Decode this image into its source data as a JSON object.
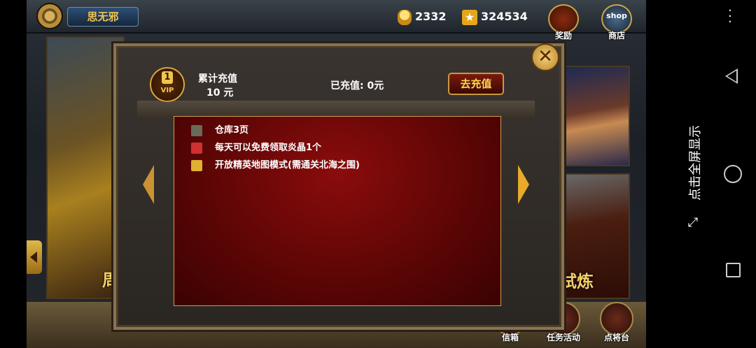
{
  "player": {
    "name": "思无邪"
  },
  "resources": {
    "gold": "2332",
    "gems": "324534"
  },
  "top_buttons": {
    "reward": "奖励",
    "shop_label": "商店",
    "shop_badge": "shop"
  },
  "side_text": {
    "banner": "试炼",
    "left_banner": "周"
  },
  "dialog": {
    "vip_level": "1",
    "vip_text": "VIP",
    "cumulative_title": "累计充值",
    "cumulative_amount": "10 元",
    "charged": "已充值: 0元",
    "recharge_button": "去充值",
    "close": "✕",
    "benefits": [
      {
        "icon": "chest-icon",
        "text": "仓库3页"
      },
      {
        "icon": "gift-icon",
        "text": "每天可以免费领取炎晶1个"
      },
      {
        "icon": "map-icon",
        "text": "开放精英地图模式(需通关北海之围)"
      }
    ]
  },
  "bottom_buttons": {
    "mail": "信箱",
    "tasks": "任务活动",
    "generals": "点将台"
  },
  "system": {
    "fullscreen_hint": "点击全屏显示"
  },
  "colors": {
    "accent_gold": "#f0c54e",
    "panel_red": "#6a0808",
    "border_gold": "#c8a050"
  }
}
